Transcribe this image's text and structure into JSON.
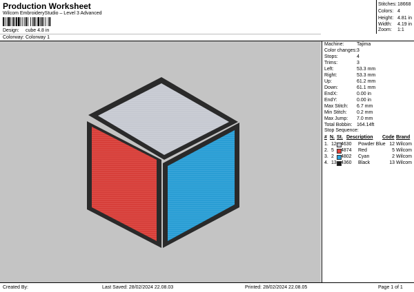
{
  "header": {
    "title": "Production Worksheet",
    "subtitle": "Wilcom EmbroideryStudio – Level 3 Advanced",
    "design_label": "Design:",
    "design_value": "cube 4.8 in",
    "colorway_label": "Colorway:",
    "colorway_value": "Colorway 1"
  },
  "stats": [
    {
      "label": "Stitches:",
      "value": "18668"
    },
    {
      "label": "Colors:",
      "value": "4"
    },
    {
      "label": "Height:",
      "value": "4.81 in"
    },
    {
      "label": "Width:",
      "value": "4.19 in"
    },
    {
      "label": "Zoom:",
      "value": "1:1"
    }
  ],
  "machine_info": [
    {
      "label": "Machine:",
      "value": "Tajima"
    },
    {
      "label": "Color changes:",
      "value": "3"
    },
    {
      "label": "Stops:",
      "value": "4"
    },
    {
      "label": "Trims:",
      "value": "3"
    },
    {
      "label": "Left:",
      "value": "53.3 mm"
    },
    {
      "label": "Right:",
      "value": "53.3 mm"
    },
    {
      "label": "Up:",
      "value": "61.2 mm"
    },
    {
      "label": "Down:",
      "value": "61.1 mm"
    },
    {
      "label": "EndX:",
      "value": "0.00 in"
    },
    {
      "label": "EndY:",
      "value": "0.00 in"
    },
    {
      "label": "Max Stitch:",
      "value": "6.7 mm"
    },
    {
      "label": "Min Stitch:",
      "value": "0.2 mm"
    },
    {
      "label": "Max Jump:",
      "value": "7.0 mm"
    },
    {
      "label": "Total Bobbin:",
      "value": "164.14ft"
    }
  ],
  "stop_sequence": {
    "title": "Stop Sequence:",
    "headers": {
      "num": "#",
      "n": "N.",
      "st": "St.",
      "description": "Description",
      "code": "Code",
      "brand": "Brand"
    },
    "rows": [
      {
        "num": "1.",
        "n": "12",
        "st": "4630",
        "color": "#c8cbd3",
        "description": "Powder Blue",
        "code": "12",
        "brand": "Wilcom"
      },
      {
        "num": "2.",
        "n": "5",
        "st": "4874",
        "color": "#e0403a",
        "description": "Red",
        "code": "5",
        "brand": "Wilcom"
      },
      {
        "num": "3.",
        "n": "2",
        "st": "4802",
        "color": "#2aa2dc",
        "description": "Cyan",
        "code": "2",
        "brand": "Wilcom"
      },
      {
        "num": "4.",
        "n": "13",
        "st": "4360",
        "color": "#1a1a1a",
        "description": "Black",
        "code": "13",
        "brand": "Wilcom"
      }
    ]
  },
  "design_colors": {
    "background": "#c4c4c4",
    "top": "#c8cbd3",
    "left": "#d9403a",
    "right": "#2a9fd6",
    "outline": "#2a2a2a"
  },
  "footer": {
    "created_by": "Created By:",
    "last_saved": "Last Saved: 28/02/2024 22.08.03",
    "printed": "Printed: 28/02/2024 22.08.05",
    "page": "Page 1 of 1"
  }
}
